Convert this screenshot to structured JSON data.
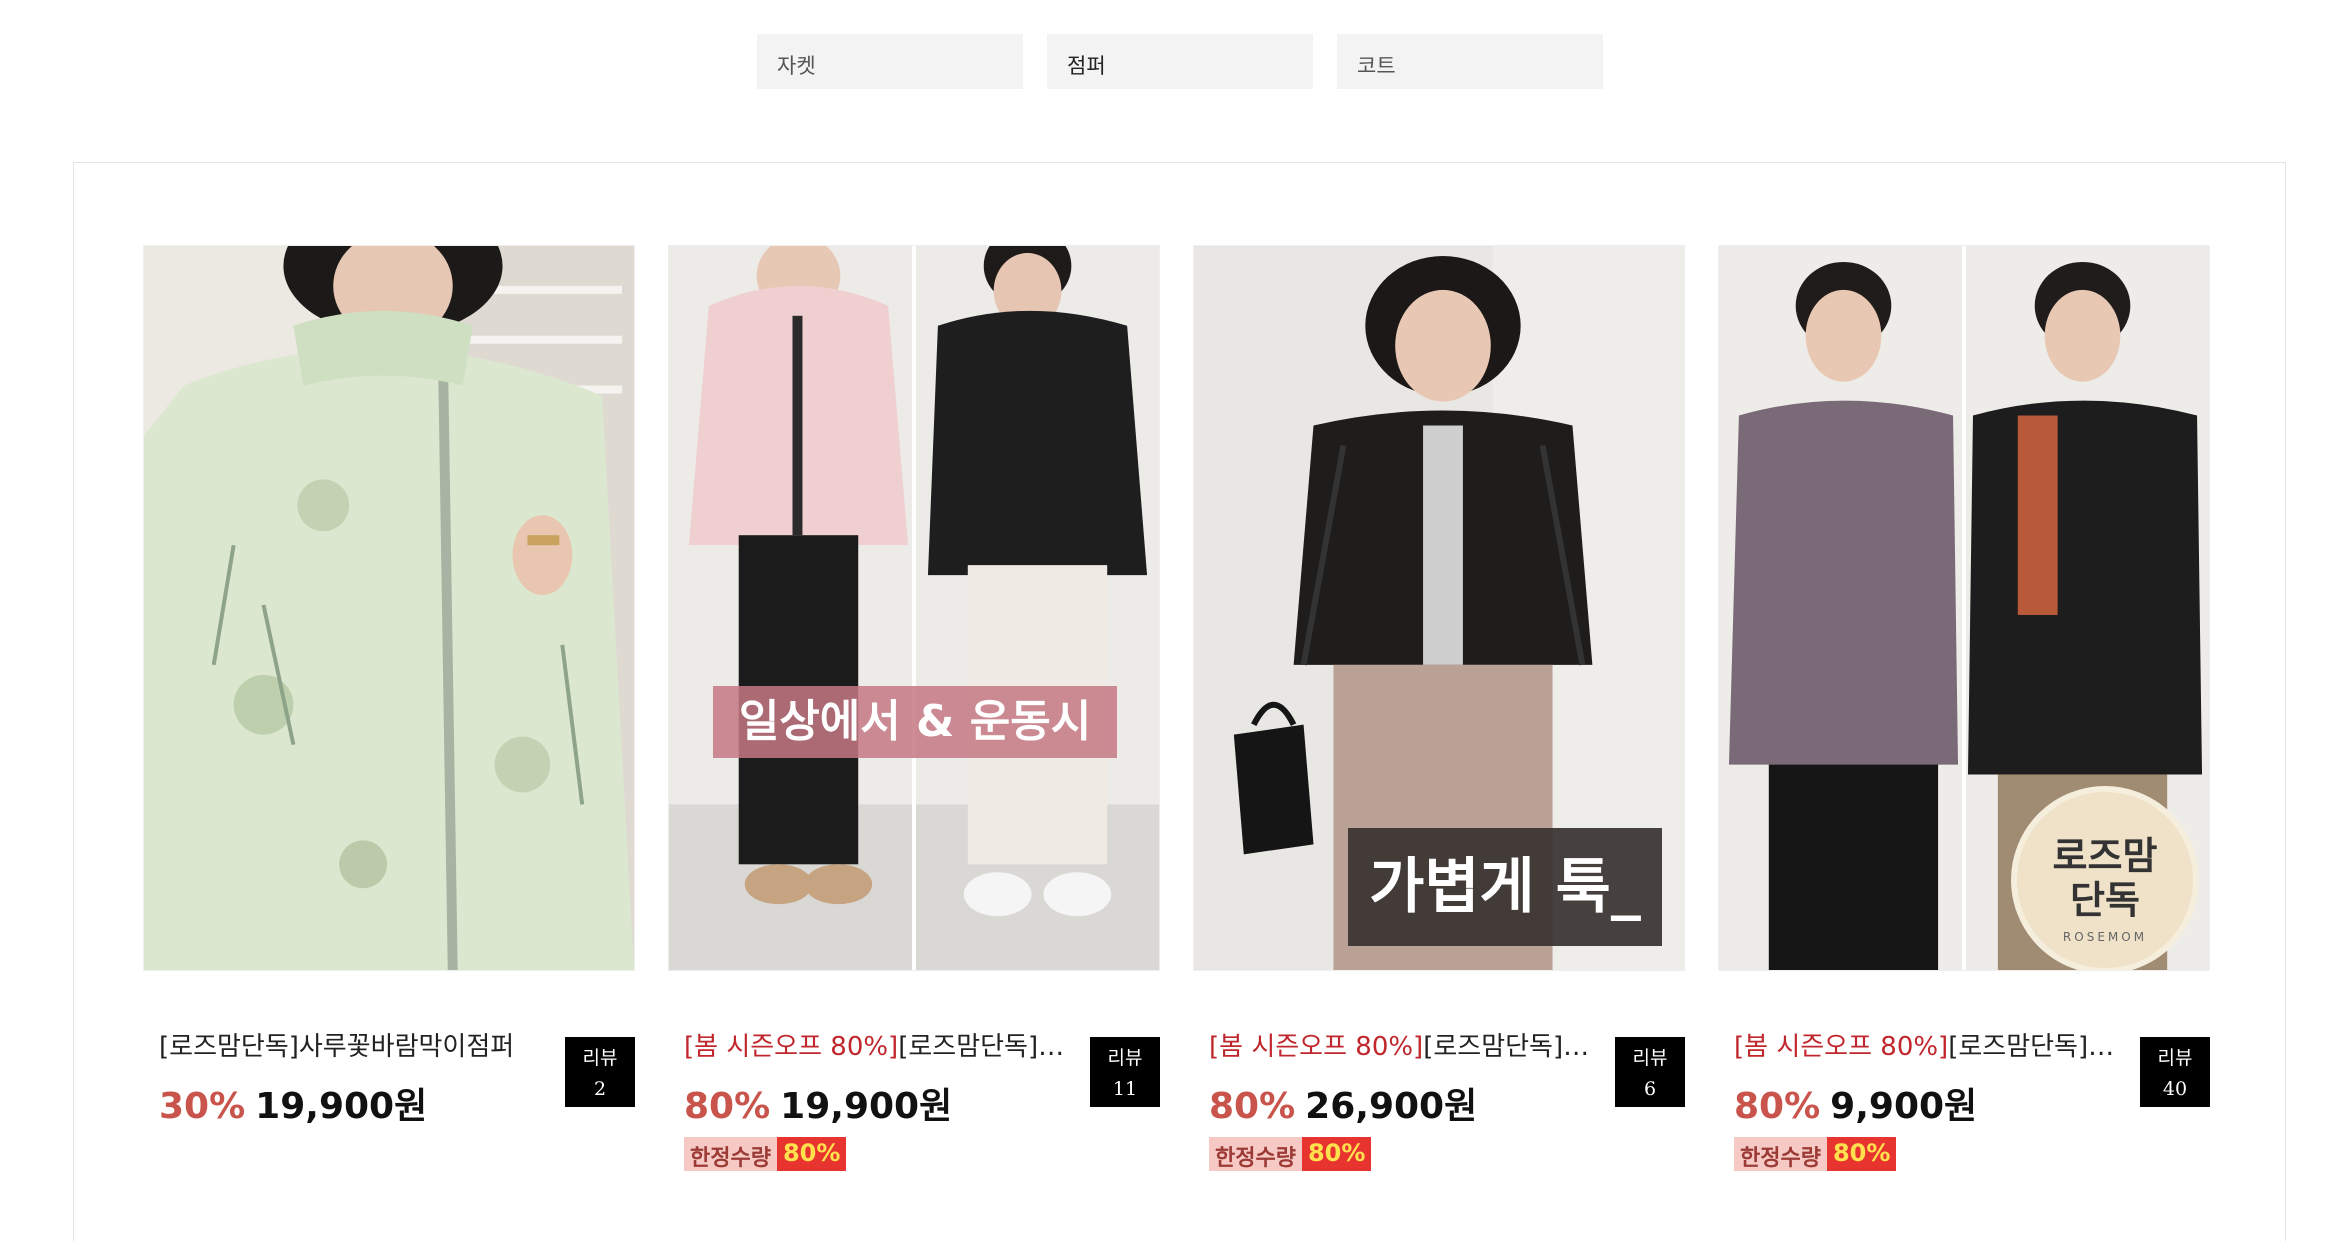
{
  "tabs": [
    {
      "label": "자켓"
    },
    {
      "label": "점퍼"
    },
    {
      "label": "코트"
    }
  ],
  "products": [
    {
      "promo": "",
      "name": "[로즈맘단독]사루꽃바람막이점퍼",
      "discount": "30%",
      "price": "19,900원",
      "review_label": "리뷰",
      "review_count": "2",
      "limited": null,
      "overlay": ""
    },
    {
      "promo": "[봄 시즌오프 80%]",
      "name": "[로즈맘단독]바람막이점퍼",
      "discount": "80%",
      "price": "19,900원",
      "review_label": "리뷰",
      "review_count": "11",
      "limited": {
        "label": "한정수량",
        "pct": "80%"
      },
      "overlay": "일상에서 & 운동시"
    },
    {
      "promo": "[봄 시즌오프 80%]",
      "name": "[로즈맘단독]누빔점퍼",
      "discount": "80%",
      "price": "26,900원",
      "review_label": "리뷰",
      "review_count": "6",
      "limited": {
        "label": "한정수량",
        "pct": "80%"
      },
      "overlay": "가볍게 툭_"
    },
    {
      "promo": "[봄 시즌오프 80%]",
      "name": "[로즈맘단독]퀼팅점퍼",
      "discount": "80%",
      "price": "9,900원",
      "review_label": "리뷰",
      "review_count": "40",
      "limited": {
        "label": "한정수량",
        "pct": "80%"
      },
      "overlay": "",
      "badge": {
        "line1": "로즈맘",
        "line2": "단독",
        "sub": "ROSEMOM"
      }
    }
  ]
}
